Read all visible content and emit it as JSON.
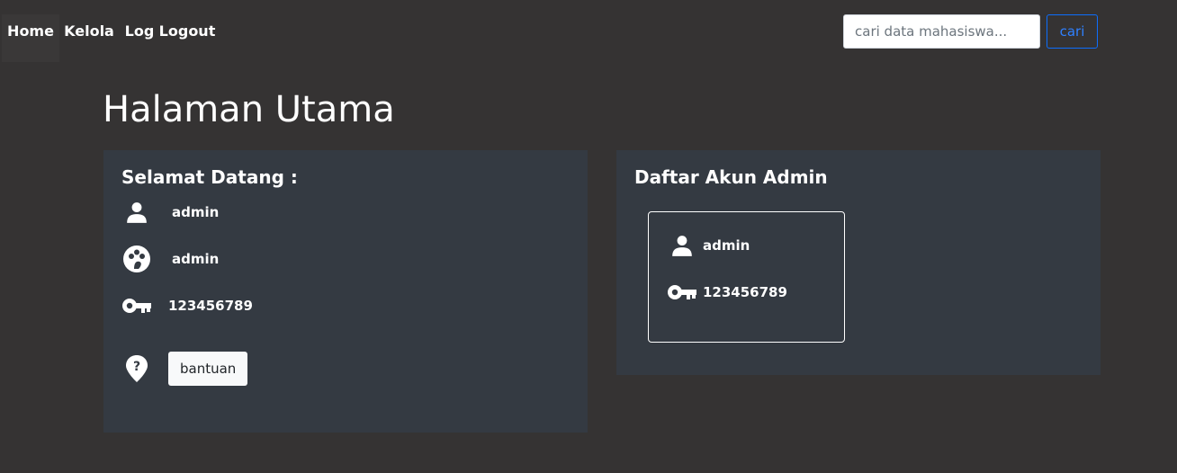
{
  "nav": {
    "items": [
      {
        "label": "Home"
      },
      {
        "label": "Kelola"
      },
      {
        "label": "Log"
      },
      {
        "label": "Logout"
      }
    ]
  },
  "search": {
    "placeholder": "cari data mahasiswa...",
    "value": "",
    "button_label": "cari"
  },
  "page": {
    "title": "Halaman Utama"
  },
  "welcome_card": {
    "heading": "Selamat Datang :",
    "username": "admin",
    "role": "admin",
    "password": "123456789",
    "help_button": "bantuan",
    "icons": [
      "user-icon",
      "palette-icon",
      "key-icon",
      "help-location-icon"
    ]
  },
  "admin_card": {
    "heading": "Daftar Akun Admin",
    "accounts": [
      {
        "username": "admin",
        "password": "123456789"
      }
    ]
  },
  "colors": {
    "background": "#353333",
    "card": "#343a42",
    "accent": "#0d6efd"
  }
}
